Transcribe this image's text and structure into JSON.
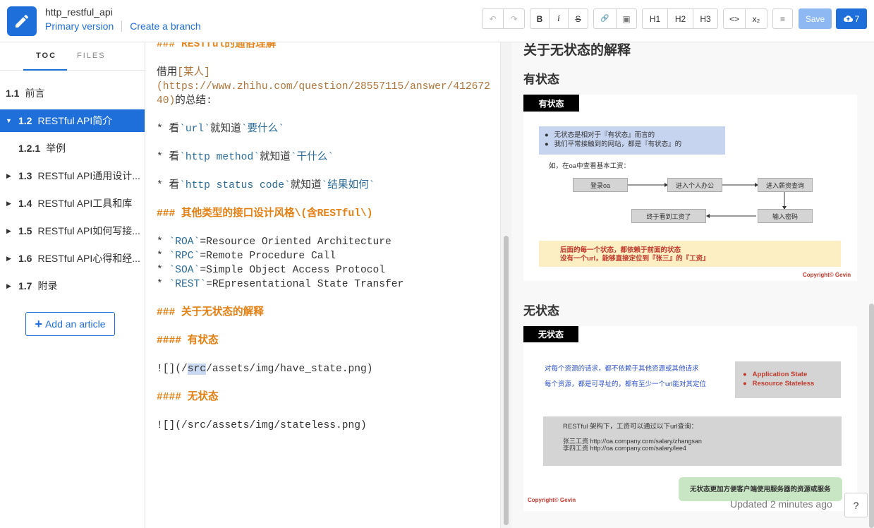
{
  "header": {
    "repo_name": "http_restful_api",
    "primary_version": "Primary version",
    "create_branch": "Create a branch",
    "toolbar": {
      "undo": "↶",
      "redo": "↷",
      "bold": "B",
      "italic": "i",
      "strike": "S",
      "link": "🔗",
      "image": "▣",
      "h1": "H1",
      "h2": "H2",
      "h3": "H3",
      "code": "<>",
      "subscript": "x₂",
      "hr": "≡"
    },
    "save_label": "Save",
    "publish_count": "7"
  },
  "sidebar": {
    "tabs": [
      "TOC",
      "FILES"
    ],
    "toc": [
      {
        "num": "1.1",
        "label": "前言"
      },
      {
        "num": "1.2",
        "label": "RESTful API简介"
      },
      {
        "num": "1.2.1",
        "label": "举例"
      },
      {
        "num": "1.3",
        "label": "RESTful API通用设计..."
      },
      {
        "num": "1.4",
        "label": "RESTful API工具和库"
      },
      {
        "num": "1.5",
        "label": "RESTful API如何写接..."
      },
      {
        "num": "1.6",
        "label": "RESTful API心得和经..."
      },
      {
        "num": "1.7",
        "label": "附录"
      }
    ],
    "add_article": "Add an article"
  },
  "editor": {
    "l0": "### RESTful的通俗理解",
    "l1a": "借用",
    "l1b": "[某人]",
    "l2": "(https://www.zhihu.com/question/28557115/answer/412672",
    "l3a": "40)",
    "l3b": "的总结:",
    "b1a": "* 看",
    "b1b": "`url`",
    "b1c": "就知道",
    "b1d": "`要什么`",
    "b2a": "* 看",
    "b2b": "`http method`",
    "b2c": "就知道",
    "b2d": "`干什么`",
    "b3a": "* 看",
    "b3b": "`http status code`",
    "b3c": "就知道",
    "b3d": "`结果如何`",
    "h_other": "### 其他类型的接口设计风格\\(含RESTful\\)",
    "r1a": "* ",
    "r1b": "`ROA`",
    "r1c": "=Resource Oriented Architecture",
    "r2a": "* ",
    "r2b": "`RPC`",
    "r2c": "=Remote Procedure Call",
    "r3a": "* ",
    "r3b": "`SOA`",
    "r3c": "=Simple Object Access Protocol",
    "r4a": "* ",
    "r4b": "`REST`",
    "r4c": "=REpresentational State Transfer",
    "h_stateless": "### 关于无状态的解释",
    "h_have": "#### 有状态",
    "img1a": "![](/",
    "img1b": "src",
    "img1c": "/assets/img/have_state.png)",
    "h_none": "#### 无状态",
    "img2": "![](/src/assets/img/stateless.png)"
  },
  "preview": {
    "h2": "关于无状态的解释",
    "h4_have": "有状态",
    "h4_none": "无状态",
    "img1": {
      "tag": "有状态",
      "note1": "无状态是相对于『有状态』而言的",
      "note2": "我们平常接触到的网站，都是『有状态』的",
      "intro": "如，在oa中查看基本工资：",
      "box1": "登录oa",
      "box2": "进入个人办公",
      "box3": "进入薪资查询",
      "box4": "输入密码",
      "box5": "终于看到工资了",
      "warn1": "后面的每一个状态，都依赖于前面的状态",
      "warn2": "没有一个url，能够直接定位到『张三』的『工资』",
      "copyright": "Copyright© Gevin"
    },
    "img2": {
      "tag": "无状态",
      "t1": "对每个资源的请求，都不依赖于其他资源或其他请求",
      "t2": "每个资源，都是可寻址的，都有至少一个url能对其定位",
      "b1": "Application State",
      "b2": "Resource Stateless",
      "q0": "RESTful 架构下，工资可以通过以下url查询：",
      "q1": "张三工资 http://oa.company.com/salary/zhangsan",
      "q2": "李四工资 http://oa.company.com/salary/lee4",
      "green": "无状态更加方便客户端使用服务器的资源或服务",
      "copyright": "Copyright© Gevin"
    }
  },
  "status": {
    "updated": "Updated 2 minutes ago",
    "help": "?"
  }
}
